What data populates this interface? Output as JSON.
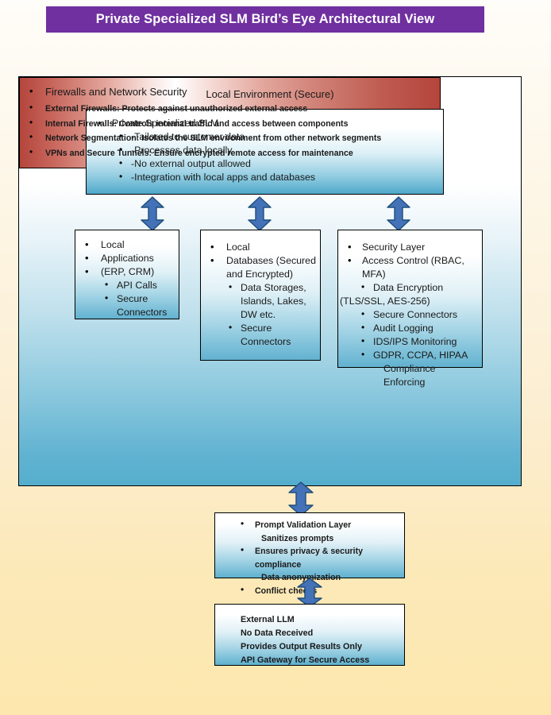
{
  "title": {
    "text": "Private Specialized SLM Bird’s Eye Architectural View",
    "banner_color": "#7030a0",
    "text_color": "#ffffff"
  },
  "container": {
    "label": "Local Environment (Secure)"
  },
  "slm_box": {
    "heading": "Private Specialized SLM",
    "items": [
      "-Tailored to customer data",
      "-Processes data locally",
      "-No external output allowed",
      "-Integration with local apps and databases"
    ]
  },
  "apps_box": {
    "lines": [
      "Local",
      "Applications",
      "(ERP, CRM)"
    ],
    "sub_items": [
      "API Calls",
      "Secure"
    ],
    "sub_continuation": "Connectors"
  },
  "db_box": {
    "lines": [
      "Local",
      "Databases (Secured"
    ],
    "line_continuation": "and Encrypted)",
    "sub_items": [
      "Data Storages,",
      "Secure"
    ],
    "sub_continuation_1": "Islands, Lakes,",
    "sub_continuation_2": "DW etc.",
    "sub_continuation_3": "Connectors"
  },
  "security_box": {
    "lines": [
      "Security Layer",
      "Access Control (RBAC, MFA)"
    ],
    "sub_items": [
      "Data Encryption",
      "Secure Connectors",
      "Audit Logging",
      "IDS/IPS Monitoring",
      "GDPR, CCPA, HIPAA"
    ],
    "encryption_continuation": "(TLS/SSL, AES-256)",
    "compliance_continuation": "Compliance Enforcing"
  },
  "firewall_box": {
    "heading": "Firewalls and Network Security",
    "items": [
      "External Firewalls: Protects against unauthorized external access",
      "Internal Firewalls: Controls internal traffic and access between components",
      "Network Segmentation: Isolates the SLM environment from other network segments",
      "VPNs and Secure Tunnels: Ensure encrypted remote access for maintenance"
    ]
  },
  "prompt_validation_box": {
    "items": [
      {
        "text": "Prompt Validation Layer",
        "bullet": true
      },
      {
        "text": "Sanitizes prompts",
        "bullet": false
      },
      {
        "text": "Ensures privacy &  security compliance",
        "bullet": true
      },
      {
        "text": "Data anonymization",
        "bullet": false
      },
      {
        "text": "Conflict checks",
        "bullet": true
      }
    ]
  },
  "external_llm_box": {
    "lines": [
      "External LLM",
      "No Data Received",
      "Provides Output Results Only",
      "API Gateway for Secure Access"
    ]
  },
  "arrows": {
    "fill_color": "#4472b8",
    "stroke_color": "#1f4e79",
    "kind": "double-headed-vertical",
    "count": 5
  },
  "colors": {
    "page_background_top": "#fffdf9",
    "page_background_bottom": "#fde7ae",
    "container_gradient_start": "#ffffff",
    "container_gradient_end": "#55aecd",
    "firewall_red": "#b4453c",
    "box_teal": "#62b2d0"
  }
}
